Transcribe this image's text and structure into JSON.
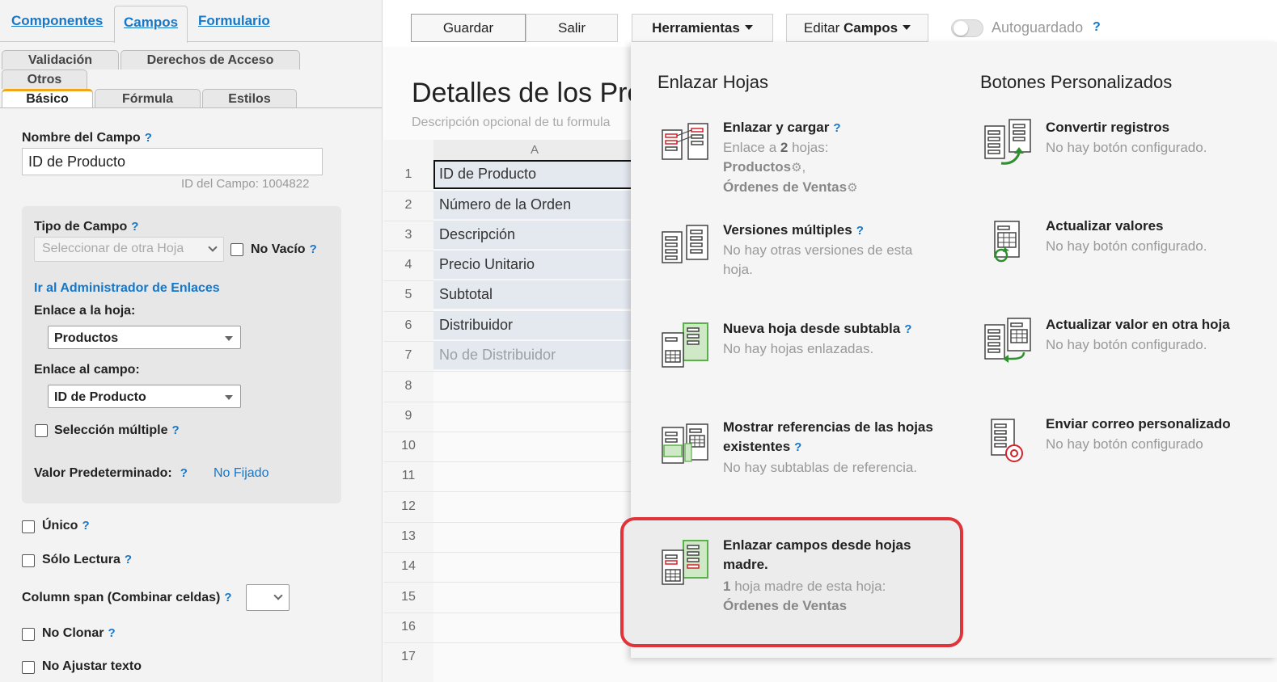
{
  "top_tabs": [
    "Componentes",
    "Campos",
    "Formulario"
  ],
  "sub_tabs": {
    "row1": [
      "Validación",
      "Derechos de Acceso"
    ],
    "row2": [
      "Otros"
    ],
    "row3": [
      "Básico",
      "Fórmula",
      "Estilos"
    ]
  },
  "field": {
    "name_label": "Nombre del Campo",
    "name_value": "ID de Producto",
    "id_hint": "ID del Campo: 1004822",
    "type_label": "Tipo de Campo",
    "type_value": "Seleccionar de otra Hoja",
    "no_empty": "No Vacío",
    "link_admin": "Ir al Administrador de Enlaces",
    "link_sheet_label": "Enlace a la hoja:",
    "link_sheet_value": "Productos",
    "link_field_label": "Enlace al campo:",
    "link_field_value": "ID de Producto",
    "multi_select": "Selección múltiple",
    "default_label": "Valor Predeterminado:",
    "default_value": "No Fijado",
    "unique": "Único",
    "readonly": "Sólo Lectura",
    "colspan_label": "Column span (Combinar celdas)",
    "no_clone": "No Clonar",
    "no_wrap": "No Ajustar texto",
    "help": "?"
  },
  "toolbar": {
    "save": "Guardar",
    "exit": "Salir",
    "tools": "Herramientas",
    "edit_prefix": "Editar",
    "edit_bold": "Campos",
    "autosave": "Autoguardado",
    "help": "?"
  },
  "form": {
    "title": "Detalles de los Pro",
    "description": "Descripción opcional de tu formula",
    "column": "A",
    "rows": [
      "1",
      "2",
      "3",
      "4",
      "5",
      "6",
      "7",
      "8",
      "9",
      "10",
      "11",
      "12",
      "13",
      "14",
      "15",
      "16",
      "17"
    ],
    "cells": [
      "ID de Producto",
      "Número de la Orden",
      "Descripción",
      "Precio Unitario",
      "Subtotal",
      "Distribuidor",
      "No de Distribuidor"
    ]
  },
  "panel": {
    "left_heading": "Enlazar Hojas",
    "right_heading": "Botones Personalizados",
    "link_upload": {
      "title": "Enlazar y cargar",
      "desc_a": "Enlace a ",
      "desc_count": "2",
      "desc_b": " hojas:",
      "sheet1": "Productos",
      "sheet2": "Órdenes de Ventas"
    },
    "versions": {
      "title": "Versiones múltiples",
      "desc": "No hay otras versiones de esta hoja."
    },
    "new_from_subtable": {
      "title": "Nueva hoja desde subtabla",
      "desc": "No hay hojas enlazadas."
    },
    "show_refs": {
      "title": "Mostrar referencias de las hojas existentes",
      "desc": "No hay subtablas de referencia."
    },
    "parent_fields": {
      "title": "Enlazar campos desde hojas madre.",
      "desc_count": "1",
      "desc_text": " hoja madre de esta hoja:",
      "sheet": "Órdenes de Ventas"
    },
    "convert": {
      "title": "Convertir registros",
      "desc": "No hay botón configurado."
    },
    "update_values": {
      "title": "Actualizar valores",
      "desc": "No hay botón configurado."
    },
    "update_other": {
      "title": "Actualizar valor en otra hoja",
      "desc": "No hay botón configurado."
    },
    "send_mail": {
      "title": "Enviar correo personalizado",
      "desc": "No hay botón configurado"
    },
    "help": "?"
  },
  "colors": {
    "link": "#1677c9",
    "accent_tab": "#f0a51a",
    "highlight": "#e0343a",
    "icon_green": "#5bb04a",
    "icon_red": "#d2232a"
  }
}
